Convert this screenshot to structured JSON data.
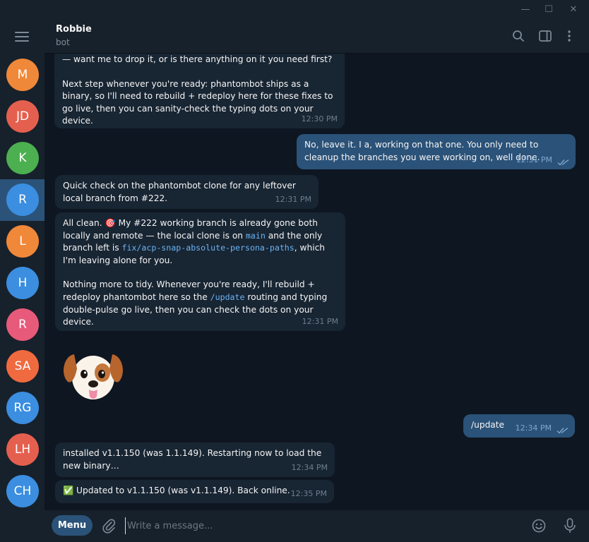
{
  "window": {
    "minimize_glyph": "—",
    "maximize_glyph": "☐",
    "close_glyph": "✕"
  },
  "sidebar": {
    "chats": [
      {
        "initials": "M",
        "color": "#f0883a"
      },
      {
        "initials": "JD",
        "color": "#e55f4e"
      },
      {
        "initials": "K",
        "color": "#4caf50"
      },
      {
        "initials": "R",
        "color": "#3b8ee0",
        "active": true
      },
      {
        "initials": "L",
        "color": "#f0883a"
      },
      {
        "initials": "H",
        "color": "#3b8ee0"
      },
      {
        "initials": "R",
        "color": "#e85a7a"
      },
      {
        "initials": "SA",
        "color": "#f06a3f"
      },
      {
        "initials": "RG",
        "color": "#3b8ee0"
      },
      {
        "initials": "LH",
        "color": "#e55f4e"
      },
      {
        "initials": "CH",
        "color": "#3b8ee0"
      }
    ]
  },
  "header": {
    "name": "Robbie",
    "status": "bot",
    "icons": [
      "search-icon",
      "sidebar-panel-icon",
      "more-vertical-icon"
    ]
  },
  "messages": {
    "m1": {
      "line1": "— want me to drop it, or is there anything on it you need first?",
      "line2": "Next step whenever you're ready: phantombot ships as a binary, so I'll need to rebuild + redeploy here for these fixes to go live, then you can sanity-check the typing dots on your device.",
      "time": "12:30 PM"
    },
    "m2": {
      "text": "No, leave it. I a, working on that one. You only need to cleanup the branches you were working on, well done.",
      "time": "12:31 PM"
    },
    "m3": {
      "text": "Quick check on the phantombot clone for any leftover local branch from #222.",
      "time": "12:31 PM"
    },
    "m4": {
      "a": "All clean. ",
      "emoji": "🎯",
      "b": " My #222 working branch is already gone both locally and remote — the local clone is on ",
      "code1": "main",
      "c": " and the only branch left is ",
      "code2": "fix/acp-snap-absolute-persona-paths",
      "d": ", which I'm leaving alone for you.",
      "e": "Nothing more to tidy. Whenever you're ready, I'll rebuild + redeploy phantombot here so the ",
      "code3": "/update",
      "f": " routing and typing double-pulse go live, then you can check the dots on your device.",
      "time": "12:31 PM"
    },
    "sticker": {
      "icon": "puppy-sticker-icon"
    },
    "m5": {
      "text": "/update",
      "time": "12:34 PM"
    },
    "m6": {
      "text": "installed v1.1.150 (was 1.1.149). Restarting now to load the new binary…",
      "time": "12:34 PM"
    },
    "m7": {
      "emoji": "✅",
      "text": " Updated to v1.1.150 (was v1.1.149). Back online.",
      "time": "12:35 PM"
    }
  },
  "composer": {
    "menu_label": "Menu",
    "placeholder": "Write a message...",
    "icons": [
      "attach-icon",
      "emoji-icon",
      "microphone-icon"
    ]
  },
  "colors": {
    "accent": "#2b5278",
    "link": "#6ab3f3",
    "background": "#0e1621",
    "panel": "#17212b",
    "incoming_bubble": "#182533"
  }
}
